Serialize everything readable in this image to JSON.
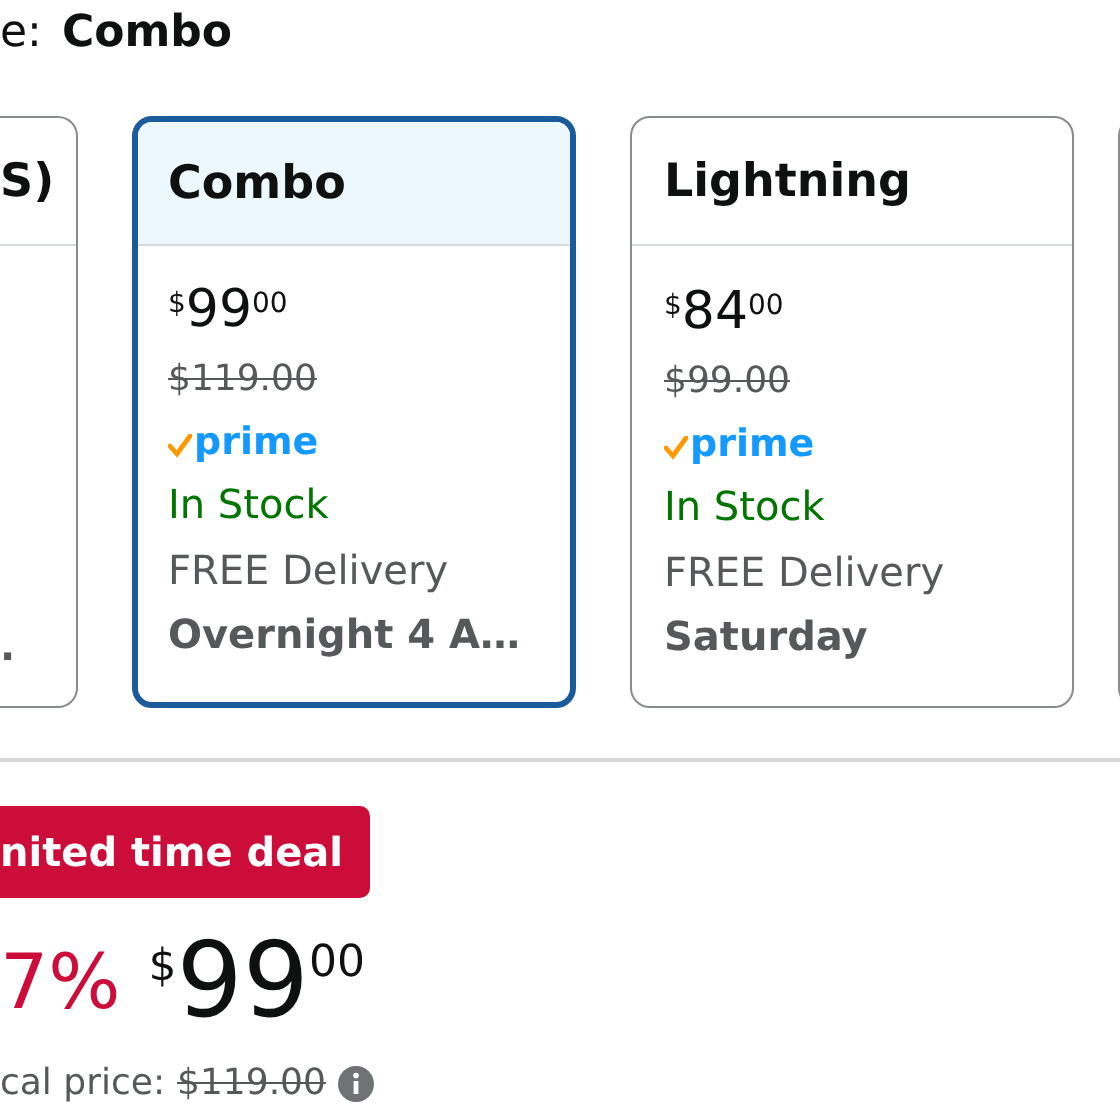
{
  "style_selector": {
    "label": "e:",
    "value": "Combo"
  },
  "options": [
    {
      "kind": "cut-left",
      "title": "S)",
      "delivery_date": ".",
      "selected": false
    },
    {
      "kind": "full",
      "title": "Combo",
      "currency": "$",
      "price_whole": "99",
      "price_fraction": "00",
      "list_price": "$119.00",
      "prime": "prime",
      "availability": "In Stock",
      "delivery": "FREE Delivery",
      "delivery_date": "Overnight 4 A…",
      "selected": true
    },
    {
      "kind": "full",
      "title": "Lightning",
      "currency": "$",
      "price_whole": "84",
      "price_fraction": "00",
      "list_price": "$99.00",
      "prime": "prime",
      "availability": "In Stock",
      "delivery": "FREE Delivery",
      "delivery_date": "Saturday",
      "selected": false
    },
    {
      "kind": "cut-right",
      "selected": false
    }
  ],
  "deal_badge": "nited time deal",
  "price": {
    "discount": "7%",
    "currency": "$",
    "whole": "99",
    "fraction": "00"
  },
  "typical_price": {
    "label": "cal price:",
    "value": "$119.00"
  }
}
